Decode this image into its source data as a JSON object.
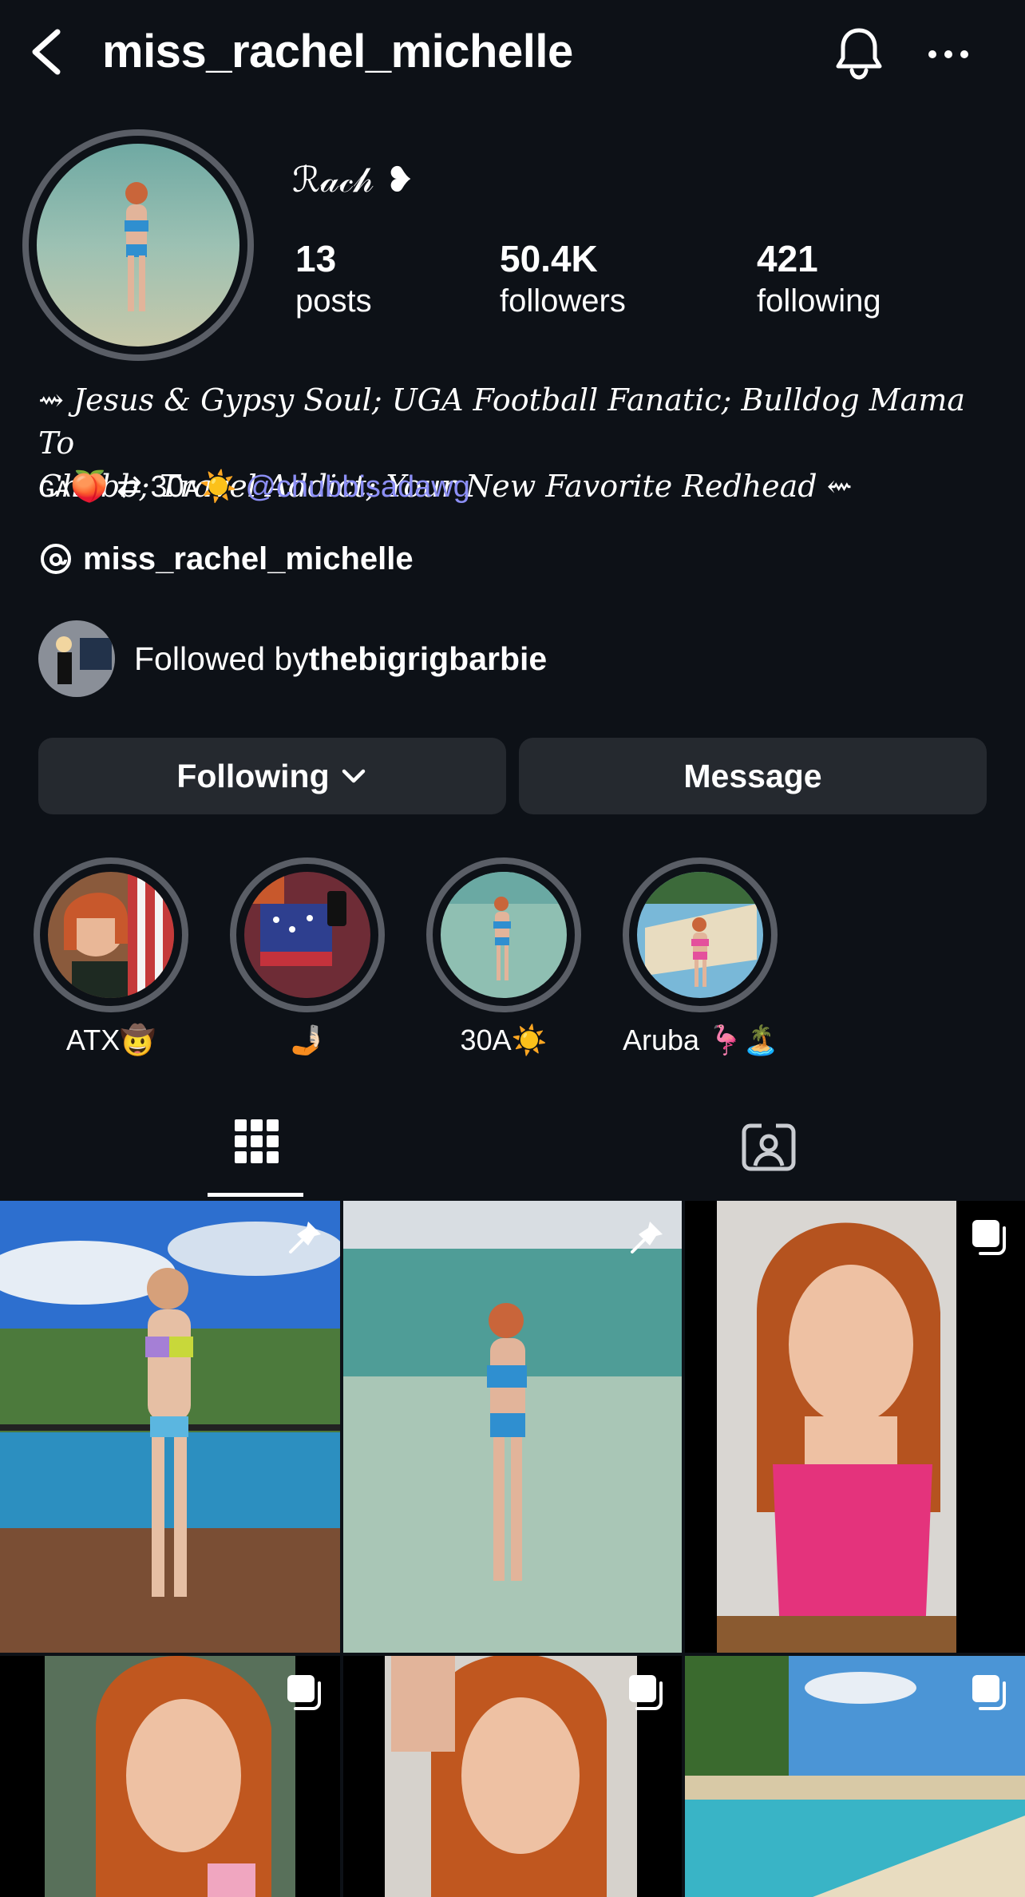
{
  "header": {
    "username": "miss_rachel_michelle",
    "back_icon": "chevron-left-icon",
    "bell_icon": "bell-icon",
    "more_icon": "more-horizontal-icon"
  },
  "profile": {
    "display_name": "ℛ𝒶𝒸𝒽 ❥",
    "stats": [
      {
        "value": "13",
        "label": "posts"
      },
      {
        "value": "50.4K",
        "label": "followers"
      },
      {
        "value": "421",
        "label": "following"
      }
    ],
    "bio_line1": "⇝ Jesus & Gypsy Soul; UGA Football Fanatic; Bulldog Mama To",
    "bio_line2": "Chubb; Travel Addict; Your New Favorite Redhead ⇜",
    "bio_line3_prefix": "ɢᴀ🍑 ⇄ 30ᴀ☀️ ",
    "bio_mention": "@chubbisadawg",
    "threads_handle": "miss_rachel_michelle",
    "followed_by_prefix": "Followed by ",
    "followed_by_name": "thebigrigbarbie"
  },
  "actions": {
    "following_label": "Following",
    "message_label": "Message"
  },
  "highlights": [
    {
      "label": "ATX🤠"
    },
    {
      "label": "🤳🏻"
    },
    {
      "label": "30A☀️"
    },
    {
      "label": "Aruba 🦩🏝️"
    }
  ],
  "tabs": {
    "grid_icon": "grid-icon",
    "tagged_icon": "tagged-person-icon"
  },
  "posts": [
    {
      "badge": "pin-icon"
    },
    {
      "badge": "pin-icon"
    },
    {
      "badge": "carousel-icon"
    },
    {
      "badge": "carousel-icon"
    },
    {
      "badge": "carousel-icon"
    },
    {
      "badge": "carousel-icon"
    }
  ]
}
